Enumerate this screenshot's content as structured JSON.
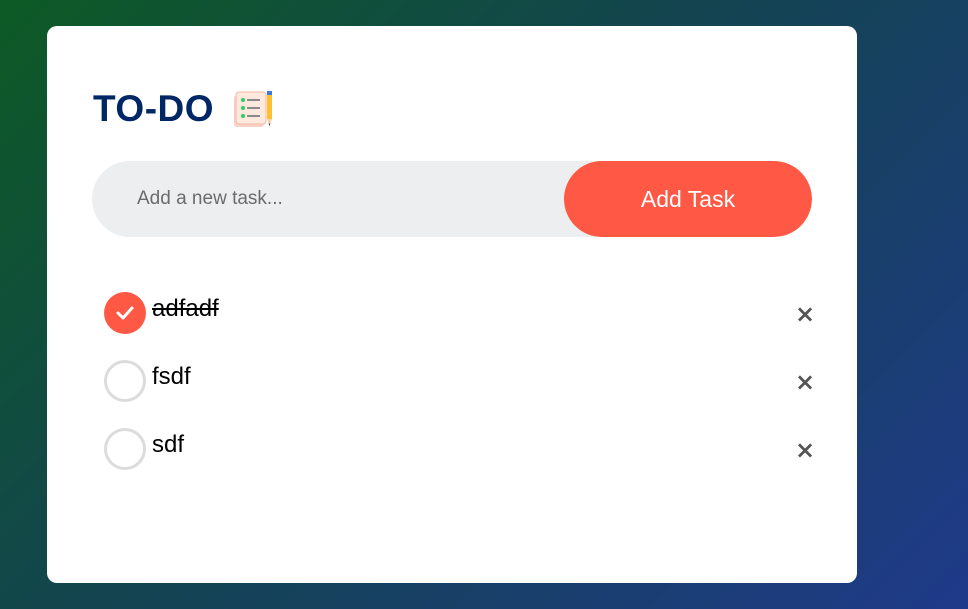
{
  "app": {
    "title": "TO-DO",
    "title_icon": "notepad-pencil-icon"
  },
  "input": {
    "value": "",
    "placeholder": "Add a new task...",
    "add_button_label": "Add Task"
  },
  "tasks": [
    {
      "text": "adfadf",
      "checked": true,
      "delete_label": "×"
    },
    {
      "text": "fsdf",
      "checked": false,
      "delete_label": "×"
    },
    {
      "text": "sdf",
      "checked": false,
      "delete_label": "×"
    }
  ],
  "colors": {
    "accent": "#ff5945",
    "title": "#002765",
    "input_bg": "#edeef0",
    "unchecked_border": "#dcdcdc"
  }
}
